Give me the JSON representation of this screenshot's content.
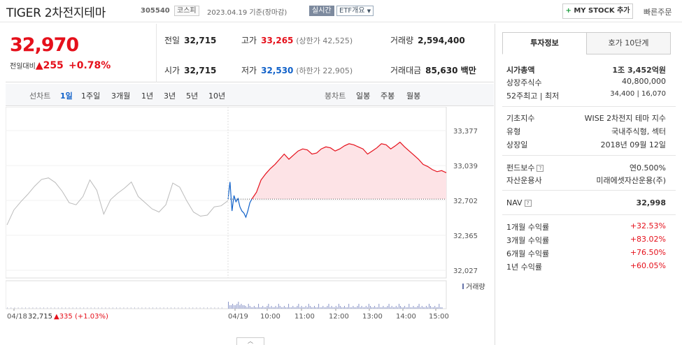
{
  "header": {
    "name": "TIGER 2차전지테마",
    "code": "305540",
    "market": "코스피",
    "date": "2023.04.19 기준(장마감)",
    "live": "실시간",
    "etf": "ETF개요",
    "mystock_plus": "+",
    "mystock": "MY STOCK 추가",
    "quick": "빠른주문"
  },
  "summary": {
    "price": "32,970",
    "change_label": "전일대비",
    "change_value": "▲255",
    "change_pct": "+0.78%",
    "prev_label": "전일",
    "prev": "32,715",
    "high_label": "고가",
    "high": "33,265",
    "upper": "(상한가 42,525)",
    "vol_label": "거래량",
    "vol": "2,594,400",
    "open_label": "시가",
    "open": "32,715",
    "low_label": "저가",
    "low": "32,530",
    "lower": "(하한가 22,905)",
    "amount_label": "거래대금",
    "amount": "85,630 백만"
  },
  "periods": {
    "line_label": "선차트",
    "items": [
      "1일",
      "1주일",
      "3개월",
      "1년",
      "3년",
      "5년",
      "10년"
    ],
    "candle_label": "봉차트",
    "candle_items": [
      "일봉",
      "주봉",
      "월봉"
    ]
  },
  "chart_data": {
    "type": "line",
    "y_ticks": [
      "33,377",
      "33,039",
      "32,702",
      "32,365",
      "32,027"
    ],
    "ylim": [
      32027,
      33377
    ],
    "x_ticks": [
      "04/18",
      "04/19",
      "10:00",
      "11:00",
      "12:00",
      "13:00",
      "14:00",
      "15:00"
    ],
    "baseline": 32715,
    "volume_label": "거래량",
    "footer_date": "04/18",
    "footer_value": "32,715",
    "footer_change": "▲335 (+1.03%)",
    "series": [
      {
        "values": [
          32465,
          32610,
          32690,
          32760,
          32840,
          32905,
          32920,
          32875,
          32790,
          32680,
          32660,
          32740,
          32900,
          32800,
          32570,
          32710,
          32770,
          32820,
          32880,
          32740,
          32680,
          32620,
          32590,
          32660,
          32870,
          32830,
          32700,
          32590,
          32550,
          32560,
          32640,
          32650,
          32700
        ]
      },
      {
        "values": [
          32715,
          32880,
          32600,
          32750,
          32690,
          32720,
          32640,
          32600,
          32580,
          32540,
          32600,
          32680,
          32715
        ]
      },
      {
        "values": [
          32715,
          32780,
          32900,
          32960,
          33010,
          33050,
          33100,
          33150,
          33100,
          33140,
          33180,
          33200,
          33190,
          33150,
          33160,
          33200,
          33220,
          33210,
          33180,
          33200,
          33230,
          33250,
          33240,
          33220,
          33200,
          33150,
          33180,
          33210,
          33250,
          33240,
          33200,
          33230,
          33265,
          33220,
          33180,
          33140,
          33100,
          33050,
          33030,
          33000,
          32980,
          32990,
          32970
        ]
      }
    ]
  },
  "right": {
    "tab1": "투자정보",
    "tab2": "호가 10단계",
    "mcap_label": "시가총액",
    "mcap": "1조 3,452억원",
    "shares_label": "상장주식수",
    "shares": "40,800,000",
    "w52_label": "52주최고 | 최저",
    "w52": "34,400 | 16,070",
    "index_label": "기초지수",
    "index": "WISE 2차전지 테마 지수",
    "type_label": "유형",
    "type": "국내주식형, 섹터",
    "listed_label": "상장일",
    "listed": "2018년 09월 12일",
    "fee_label": "펀드보수",
    "fee": "연0.500%",
    "mgr_label": "자산운용사",
    "mgr": "미래에셋자산운용(주)",
    "nav_label": "NAV",
    "nav": "32,998",
    "r1_label": "1개월 수익률",
    "r1": "+32.53%",
    "r3_label": "3개월 수익률",
    "r3": "+83.02%",
    "r6_label": "6개월 수익률",
    "r6": "+76.50%",
    "r12_label": "1년 수익률",
    "r12": "+60.05%",
    "help_glyph": "?",
    "colors": {
      "up": "#e5101b",
      "down": "#1061c9"
    }
  },
  "collapse_glyph": "︿"
}
